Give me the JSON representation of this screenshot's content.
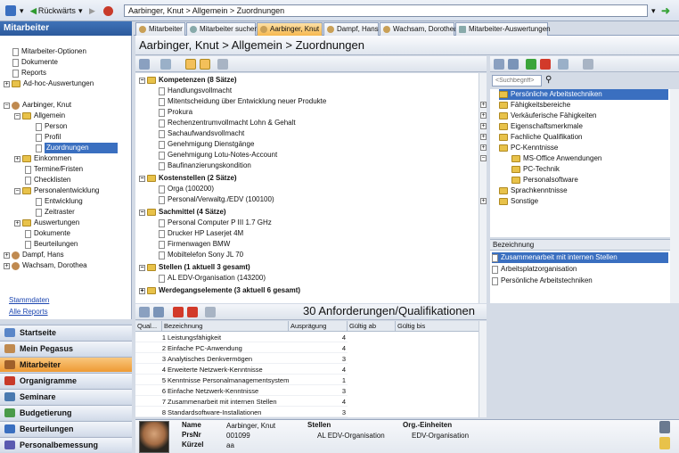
{
  "toolbar": {
    "back_label": "Rückwärts",
    "address": "Aarbinger, Knut > Allgemein > Zuordnungen"
  },
  "left": {
    "header": "Mitarbeiter",
    "tree": [
      {
        "label": "Mitarbeiter-Optionen"
      },
      {
        "label": "Dokumente"
      },
      {
        "label": "Reports"
      },
      {
        "label": "Ad-hoc-Auswertungen"
      },
      {
        "label": "Aarbinger, Knut"
      },
      {
        "label": "Allgemein"
      },
      {
        "label": "Person"
      },
      {
        "label": "Profil"
      },
      {
        "label": "Zuordnungen"
      },
      {
        "label": "Einkommen"
      },
      {
        "label": "Termine/Fristen"
      },
      {
        "label": "Checklisten"
      },
      {
        "label": "Personalentwicklung"
      },
      {
        "label": "Entwicklung"
      },
      {
        "label": "Zeitraster"
      },
      {
        "label": "Auswertungen"
      },
      {
        "label": "Dokumente"
      },
      {
        "label": "Beurteilungen"
      },
      {
        "label": "Dampf, Hans"
      },
      {
        "label": "Wachsam, Dorothea"
      }
    ],
    "links": [
      "Stammdaten",
      "Alle Reports"
    ],
    "nav": [
      "Startseite",
      "Mein Pegasus",
      "Mitarbeiter",
      "Organigramme",
      "Seminare",
      "Budgetierung",
      "Beurteilungen",
      "Personalbemessung"
    ]
  },
  "tabs": [
    "Mitarbeiter",
    "Mitarbeiter suchen",
    "Aarbinger, Knut",
    "Dampf, Hans",
    "Wachsam, Dorothea",
    "Mitarbeiter-Auswertungen"
  ],
  "page_title": "Aarbinger, Knut > Allgemein > Zuordnungen",
  "center_tree": [
    {
      "label": "Kompetenzen (8 Sätze)",
      "group": true
    },
    {
      "label": "Handlungsvollmacht"
    },
    {
      "label": "Mitentscheidung über Entwicklung neuer Produkte"
    },
    {
      "label": "Prokura"
    },
    {
      "label": "Rechenzentrumvollmacht Lohn & Gehalt"
    },
    {
      "label": "Sachaufwandsvollmacht"
    },
    {
      "label": "Genehmigung Dienstgänge"
    },
    {
      "label": "Genehmigung Lotu-Notes-Account"
    },
    {
      "label": "Baufinanzierungskondition"
    },
    {
      "label": "Kostenstellen (2 Sätze)",
      "group": true
    },
    {
      "label": "Orga (100200)"
    },
    {
      "label": "Personal/Verwaltg./EDV (100100)"
    },
    {
      "label": "Sachmittel (4 Sätze)",
      "group": true
    },
    {
      "label": "Personal Computer P III 1.7 GHz"
    },
    {
      "label": "Drucker HP Laserjet 4M"
    },
    {
      "label": "Firmenwagen BMW"
    },
    {
      "label": "Mobiltelefon Sony JL 70"
    },
    {
      "label": "Stellen (1 aktuell 3 gesamt)",
      "group": true
    },
    {
      "label": "AL EDV-Organisation (143200)"
    },
    {
      "label": "Werdegangselemente (3 aktuell 6 gesamt)",
      "group": true
    }
  ],
  "right": {
    "search_placeholder": "<Suchbegriff>",
    "tree": [
      {
        "label": "Persönliche Arbeitstechniken",
        "selected": true
      },
      {
        "label": "Fähigkeitsbereiche"
      },
      {
        "label": "Verkäuferische Fähigkeiten"
      },
      {
        "label": "Eigenschaftsmerkmale"
      },
      {
        "label": "Fachliche Qualifikation"
      },
      {
        "label": "PC-Kenntnisse"
      },
      {
        "label": "MS-Office Anwendungen"
      },
      {
        "label": "PC-Technik"
      },
      {
        "label": "Personalsoftware"
      },
      {
        "label": "Sprachkenntnisse"
      },
      {
        "label": "Sonstige"
      }
    ],
    "list_header": "Bezeichnung",
    "list": [
      "Zusammenarbeit mit internen Stellen",
      "Arbeitsplatzorganisation",
      "Persönliche Arbeitstechniken"
    ]
  },
  "bottom": {
    "title": "30 Anforderungen/Qualifikationen",
    "headers": [
      "Qual...",
      "Bezeichnung",
      "Ausprägung",
      "Gültig ab",
      "Gültig bis"
    ],
    "rows": [
      [
        "1",
        "Leistungsfähigkeit",
        "4"
      ],
      [
        "2",
        "Einfache PC-Anwendung",
        "4"
      ],
      [
        "3",
        "Analytisches Denkvermögen",
        "3"
      ],
      [
        "4",
        "Erweiterte Netzwerk-Kenntnisse",
        "4"
      ],
      [
        "5",
        "Kenntnisse Personalmanagementsystem",
        "1"
      ],
      [
        "6",
        "Einfache Netzwerk-Kenntnisse",
        "3"
      ],
      [
        "7",
        "Zusammenarbeit mit internen Stellen",
        "4"
      ],
      [
        "8",
        "Standardsoftware-Installationen",
        "3"
      ]
    ]
  },
  "detail": {
    "labels": {
      "name": "Name",
      "prsnr": "PrsNr",
      "kuerzel": "Kürzel",
      "stellen": "Stellen",
      "org": "Org.-Einheiten"
    },
    "values": {
      "name": "Aarbinger, Knut",
      "prsnr": "001099",
      "kuerzel": "aa",
      "stelle": "AL EDV-Organisation",
      "org": "EDV-Organisation"
    }
  }
}
